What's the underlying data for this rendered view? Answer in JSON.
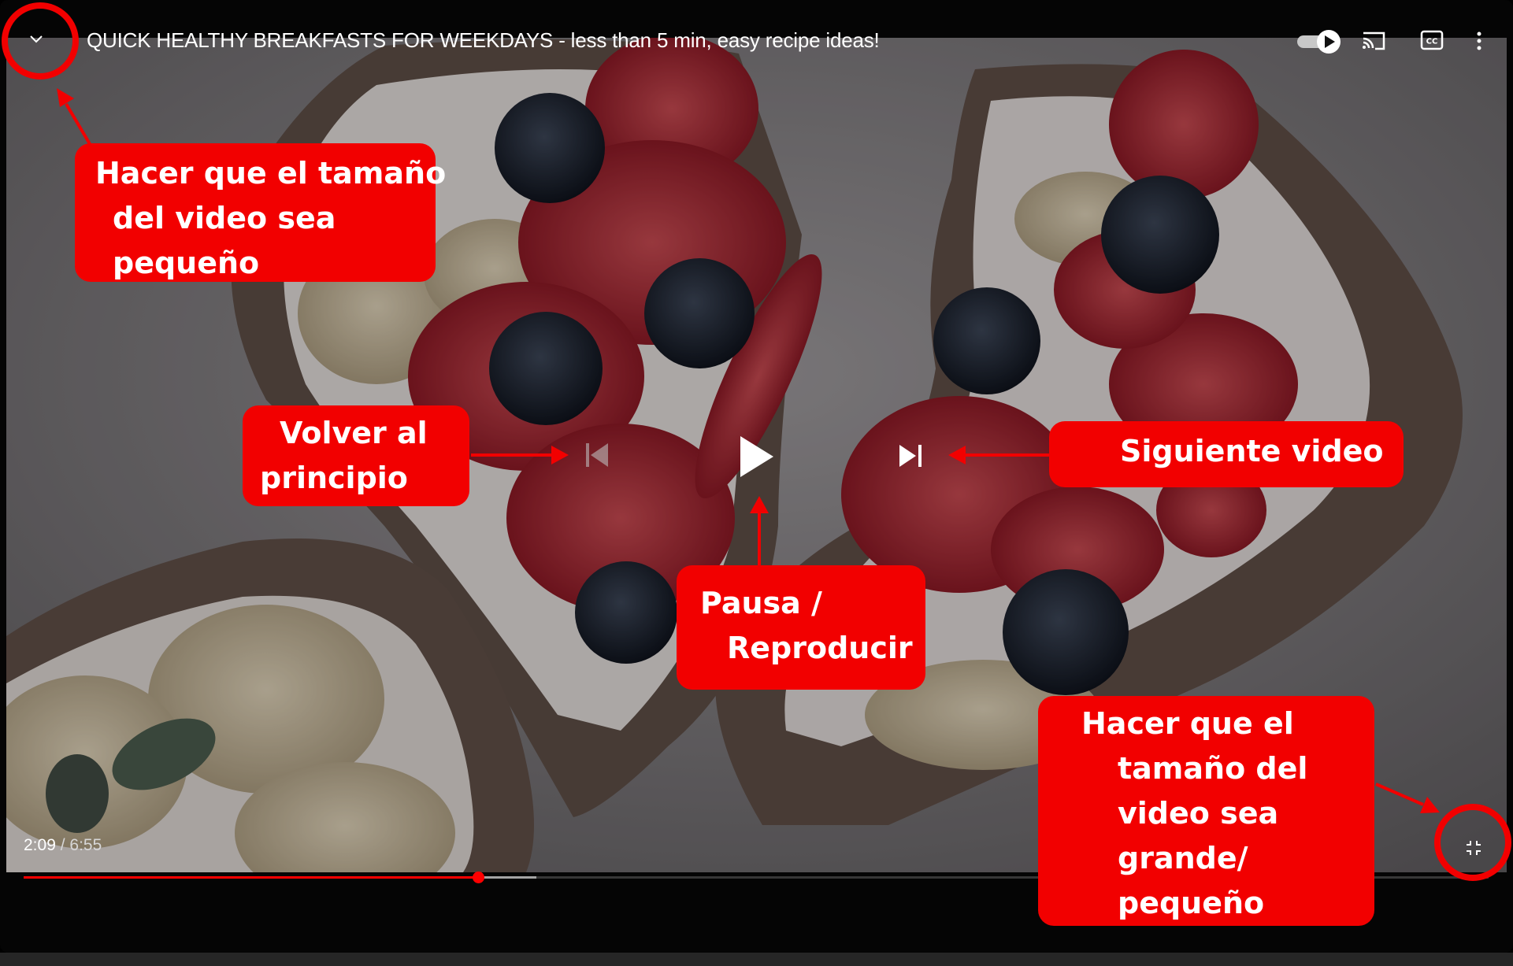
{
  "video": {
    "title": "QUICK HEALTHY BREAKFASTS FOR WEEKDAYS - less than 5 min, easy recipe ideas!",
    "current_time": "2:09",
    "separator": " / ",
    "duration": "6:55",
    "progress": 0.31,
    "buffered": 0.35
  },
  "icons": {
    "minimize": "chevron-down-icon",
    "autoplay": "autoplay-toggle-icon",
    "cast": "cast-icon",
    "captions": "captions-icon",
    "more": "more-vertical-icon",
    "previous": "skip-previous-icon",
    "play": "play-icon",
    "next": "skip-next-icon",
    "exit_fullscreen": "exit-fullscreen-icon"
  },
  "annotations": {
    "minimize": [
      "Hacer que el tamaño",
      "del video sea",
      "pequeño"
    ],
    "previous": [
      "Volver al",
      "principio"
    ],
    "next": [
      "Siguiente video"
    ],
    "play": [
      "Pausa /",
      "Reproducir"
    ],
    "fullscreen": [
      "Hacer que el",
      "tamaño del",
      "video sea",
      "grande/",
      "pequeño"
    ]
  },
  "colors": {
    "annotation_red": "#f20000",
    "progress_red": "#ff0000"
  }
}
